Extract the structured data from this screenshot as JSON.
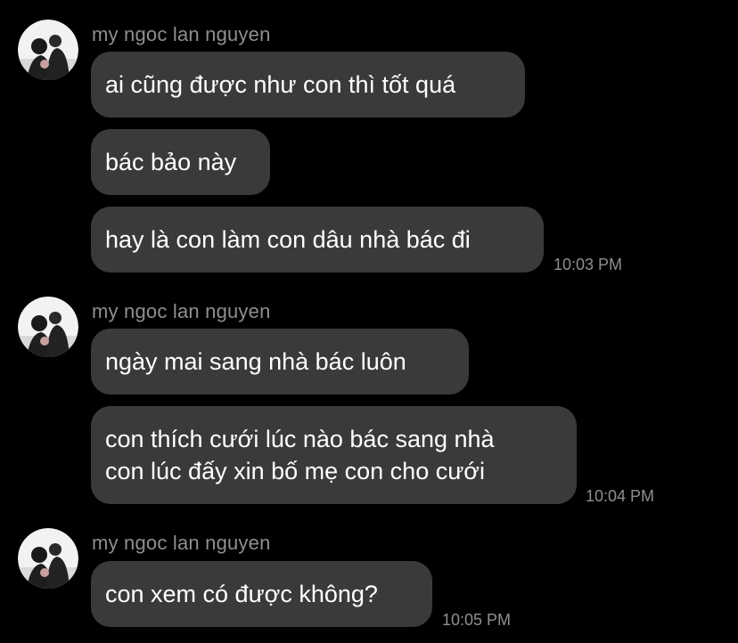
{
  "groups": [
    {
      "sender": "my ngoc lan nguyen",
      "messages": [
        "ai cũng được như con thì tốt quá",
        "bác bảo này",
        "hay là con làm con dâu nhà bác đi"
      ],
      "time": "10:03 PM"
    },
    {
      "sender": "my ngoc lan nguyen",
      "messages": [
        "ngày mai sang nhà bác luôn",
        [
          "con thích cưới lúc nào bác sang nhà",
          "con lúc đấy xin bố mẹ con cho cưới"
        ]
      ],
      "time": "10:04 PM"
    },
    {
      "sender": "my ngoc lan nguyen",
      "messages": [
        "con xem có được không?"
      ],
      "time": "10:05 PM"
    }
  ],
  "colors": {
    "background": "#000000",
    "bubble": "#3a3a3c",
    "meta_text": "#8e8e93",
    "message_text": "#ffffff"
  },
  "icons": {
    "avatar": "profile-photo-avatar-icon"
  }
}
